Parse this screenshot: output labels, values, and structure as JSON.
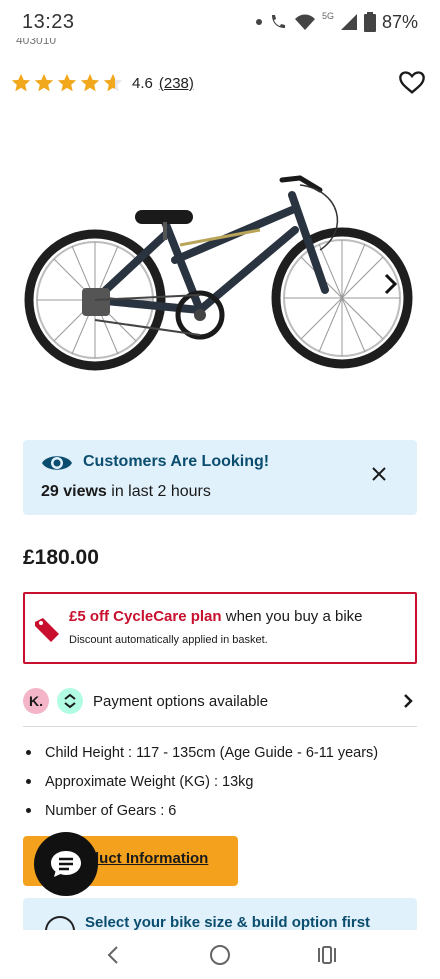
{
  "status_bar": {
    "time": "13:23",
    "network": "5G",
    "battery": "87%"
  },
  "product": {
    "sku_partial": "403010",
    "rating": {
      "value": "4.6",
      "count": "(238)",
      "stars": 4.6
    },
    "price": "£180.00"
  },
  "looking_banner": {
    "title": "Customers Are Looking!",
    "views_bold": "29 views",
    "views_rest": " in last 2 hours"
  },
  "promo": {
    "strong": "£5 off CycleCare plan",
    "rest": " when you buy a bike",
    "note": "Discount automatically applied in basket."
  },
  "payment": {
    "klarna_label": "K.",
    "label": "Payment options available"
  },
  "specs": [
    "Child Height : 117 - 135cm (Age Guide - 6-11 years)",
    "Approximate Weight (KG) : 13kg",
    "Number of Gears : 6"
  ],
  "info_button": {
    "label": "Product Information"
  },
  "size_banner": {
    "label": "Select your bike size & build option first"
  },
  "colors": {
    "accent_orange": "#f4a21d",
    "promo_red": "#c8102e",
    "banner_blue": "#e1f1fb",
    "banner_text": "#0b4d6e",
    "star_gold": "#f2a81c"
  },
  "icons": {
    "heart": "heart-icon",
    "eye": "eye-icon",
    "close": "close-icon",
    "tag": "tag-icon",
    "chat": "chat-icon",
    "chevron_right": "chevron-right-icon"
  }
}
